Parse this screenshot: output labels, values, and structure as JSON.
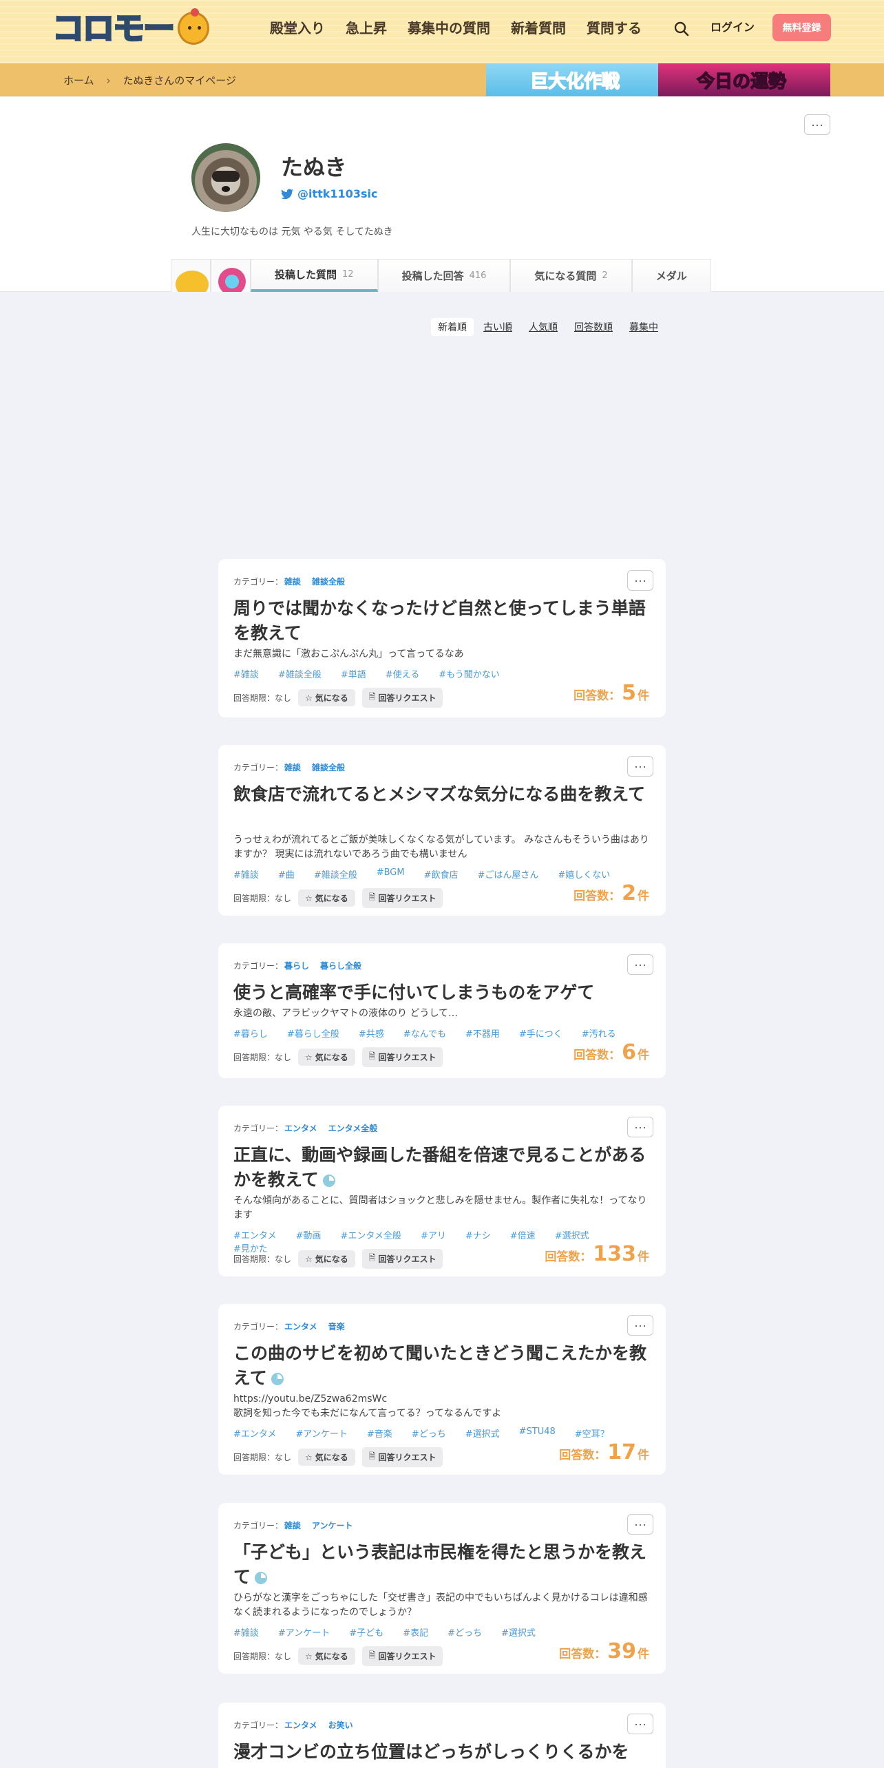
{
  "header": {
    "logo_text": "コロモー",
    "nav": [
      "殿堂入り",
      "急上昇",
      "募集中の質問",
      "新着質問",
      "質問する"
    ],
    "login": "ログイン",
    "signup": "無料登録"
  },
  "breadcrumb": {
    "home": "ホーム",
    "sep": "›",
    "current": "たぬきさんのマイページ"
  },
  "banners": {
    "left": "巨大化作戦",
    "right": "今日の運勢"
  },
  "profile": {
    "more": "···",
    "name": "たぬき",
    "twitter": "@ittk1103sic",
    "bio": "人生に大切なものは 元気 やる気 そしてたぬき",
    "tabs": [
      {
        "label": "投稿した質問",
        "count": "12"
      },
      {
        "label": "投稿した回答",
        "count": "416"
      },
      {
        "label": "気になる質問",
        "count": "2"
      },
      {
        "label": "メダル",
        "count": ""
      }
    ]
  },
  "sort": {
    "options": [
      "新着順",
      "古い順",
      "人気順",
      "回答数順",
      "募集中"
    ]
  },
  "card_common": {
    "cat_label": "カテゴリー：",
    "deadline": "回答期限：なし",
    "watch": "気になる",
    "request": "回答リクエスト",
    "answers_label": "回答数：",
    "answers_unit": "件",
    "more": "···"
  },
  "questions": [
    {
      "cats": [
        "雑談",
        "雑談全般"
      ],
      "title": "周りでは聞かなくなったけど自然と使ってしまう単語を教えて",
      "body": [
        "まだ無意識に「激おこぷんぷん丸」って言ってるなあ"
      ],
      "tags": [
        "#雑談",
        "#雑談全般",
        "#単語",
        "#使える",
        "#もう聞かない"
      ],
      "answers": "5"
    },
    {
      "cats": [
        "雑談",
        "雑談全般"
      ],
      "title": "飲食店で流れてるとメシマズな気分になる曲を教えて",
      "body": [
        "うっせぇわが流れてるとご飯が美味しくなくなる気がしています。 みなさんもそういう曲はありますか？ 現実には流れないであろう曲でも構いません"
      ],
      "tags": [
        "#雑談",
        "#曲",
        "#雑談全般",
        "#BGM",
        "#飲食店",
        "#ごはん屋さん",
        "#嬉しくない"
      ],
      "answers": "2"
    },
    {
      "cats": [
        "暮らし",
        "暮らし全般"
      ],
      "title": "使うと高確率で手に付いてしまうものをアゲて",
      "body": [
        "永遠の敵、アラビックヤマトの液体のり どうして…"
      ],
      "tags": [
        "#暮らし",
        "#暮らし全般",
        "#共感",
        "#なんでも",
        "#不器用",
        "#手につく",
        "#汚れる"
      ],
      "answers": "6"
    },
    {
      "cats": [
        "エンタメ",
        "エンタメ全般"
      ],
      "title": "正直に、動画や録画した番組を倍速で見ることがあるかを教えて",
      "body": [
        "そんな傾向があることに、質問者はショックと悲しみを隠せません。製作者に失礼な！ってなります"
      ],
      "tags": [
        "#エンタメ",
        "#動画",
        "#エンタメ全般",
        "#アリ",
        "#ナシ",
        "#倍速",
        "#選択式",
        "#見かた"
      ],
      "answers": "133"
    },
    {
      "cats": [
        "エンタメ",
        "音楽"
      ],
      "title": "この曲のサビを初めて聞いたときどう聞こえたかを教えて",
      "body": [
        "https://youtu.be/Z5zwa62msWc",
        "歌詞を知った今でも未だになんて言ってる？ってなるんですよ"
      ],
      "tags": [
        "#エンタメ",
        "#アンケート",
        "#音楽",
        "#どっち",
        "#選択式",
        "#STU48",
        "#空耳？"
      ],
      "answers": "17"
    },
    {
      "cats": [
        "雑談",
        "アンケート"
      ],
      "title": "「子ども」という表記は市民権を得たと思うかを教えて",
      "body": [
        "ひらがなと漢字をごっちゃにした「交ぜ書き」表記の中でもいちばんよく見かけるコレは違和感なく読まれるようになったのでしょうか？"
      ],
      "tags": [
        "#雑談",
        "#アンケート",
        "#子ども",
        "#表記",
        "#どっち",
        "#選択式"
      ],
      "answers": "39"
    },
    {
      "cats": [
        "エンタメ",
        "お笑い"
      ],
      "title": "漫才コンビの立ち位置はどっちがしっくりくるかを",
      "body": [],
      "tags": [],
      "answers": ""
    }
  ]
}
